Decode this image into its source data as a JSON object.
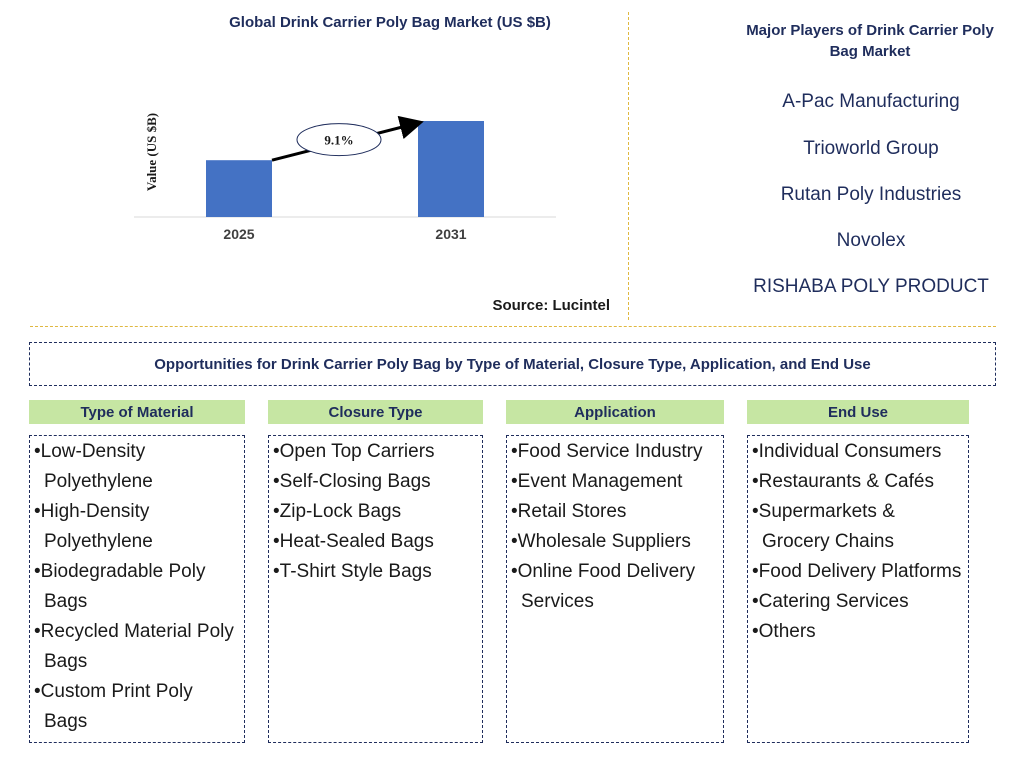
{
  "chart_data": {
    "type": "bar",
    "title": "Global Drink Carrier Poly Bag Market (US $B)",
    "ylabel": "Value (US $B)",
    "categories": [
      "2025",
      "2031"
    ],
    "values": [
      1.0,
      1.69
    ],
    "cagr_label": "9.1%",
    "bar_color": "#4472c4",
    "grid": false
  },
  "source": "Source: Lucintel",
  "players": {
    "title": "Major Players of Drink Carrier Poly Bag Market",
    "items": [
      "A-Pac Manufacturing",
      "Trioworld Group",
      "Rutan Poly Industries",
      "Novolex",
      "RISHABA POLY PRODUCT"
    ]
  },
  "opportunities": {
    "title": "Opportunities for Drink Carrier Poly Bag by Type of Material, Closure Type, Application, and End Use",
    "columns": [
      {
        "header": "Type of Material",
        "items": [
          "Low-Density Polyethylene",
          "High-Density Polyethylene",
          "Biodegradable Poly Bags",
          "Recycled Material Poly Bags",
          "Custom Print Poly Bags"
        ]
      },
      {
        "header": "Closure Type",
        "items": [
          "Open Top Carriers",
          "Self-Closing Bags",
          "Zip-Lock Bags",
          "Heat-Sealed Bags",
          "T-Shirt Style Bags"
        ]
      },
      {
        "header": "Application",
        "items": [
          "Food Service Industry",
          "Event Management",
          "Retail Stores",
          "Wholesale Suppliers",
          "Online Food Delivery Services"
        ]
      },
      {
        "header": "End Use",
        "items": [
          "Individual Consumers",
          "Restaurants & Cafés",
          "Supermarkets & Grocery Chains",
          "Food Delivery Platforms",
          "Catering Services",
          "Others"
        ]
      }
    ]
  },
  "colors": {
    "header_bg": "#c6e6a3",
    "navy": "#1f2d5c",
    "divider": "#e0b840"
  }
}
